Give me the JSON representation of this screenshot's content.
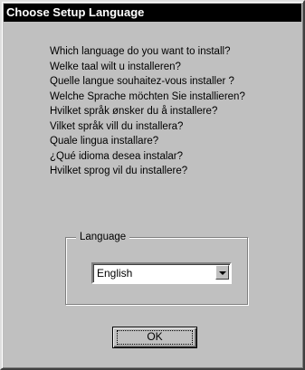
{
  "window": {
    "title": "Choose Setup Language"
  },
  "questions": [
    "Which language do you want to install?",
    "Welke taal wilt u installeren?",
    "Quelle langue souhaitez-vous installer ?",
    "Welche Sprache möchten Sie installieren?",
    "Hvilket språk ønsker du å installere?",
    "Vilket språk vill du installera?",
    "Quale lingua installare?",
    "¿Qué idioma desea instalar?",
    "Hvilket sprog vil du installere?"
  ],
  "language_group": {
    "label": "Language",
    "selected": "English"
  },
  "buttons": {
    "ok": "OK"
  },
  "icons": {
    "dropdown": "chevron-down-icon"
  },
  "colors": {
    "face": "#c0c0c0",
    "titlebar": "#000000",
    "title_text": "#ffffff"
  }
}
